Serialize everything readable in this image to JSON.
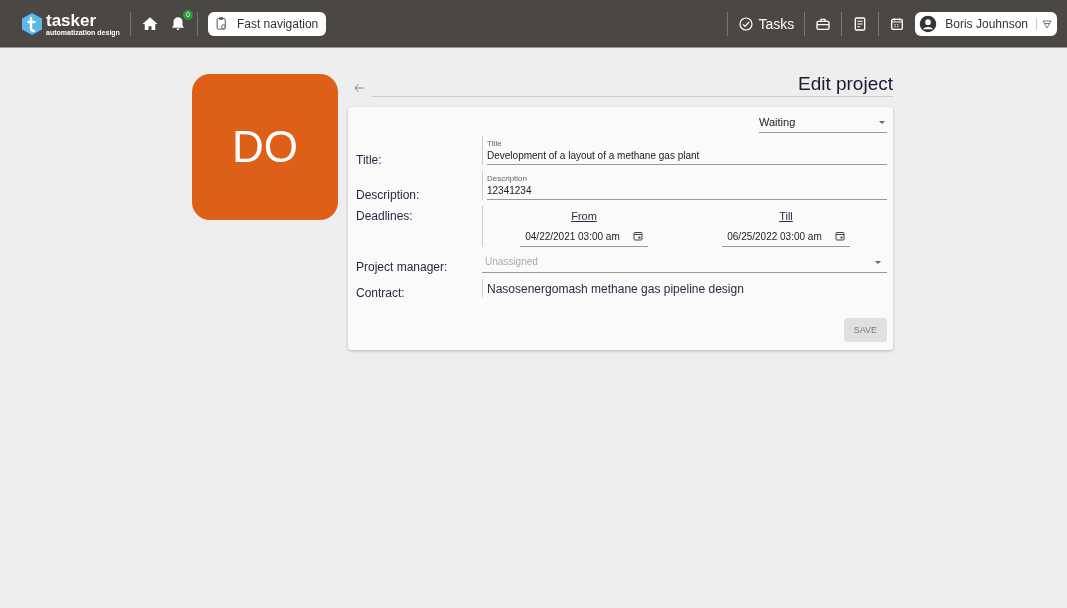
{
  "topbar": {
    "logo": {
      "name": "tasker",
      "tagline": "automatization design"
    },
    "notifications": {
      "count": "0"
    },
    "fast_navigation": "Fast navigation",
    "tasks": "Tasks",
    "user": "Boris Jouhnson"
  },
  "project": {
    "initials": "DO",
    "heading": "Edit project",
    "status": "Waiting",
    "fields": [
      {
        "label": "Title:",
        "kind": "text",
        "placeholder": "Title",
        "value": "Development of a layout of a methane gas plant"
      },
      {
        "label": "Description:",
        "kind": "text",
        "placeholder": "Description",
        "value": "12341234"
      },
      {
        "label": "Deadlines:",
        "kind": "dates",
        "dates": [
          {
            "caption": "From",
            "value": "04/22/2021 03:00 am"
          },
          {
            "caption": "Till",
            "value": "06/25/2022 03:00 am"
          }
        ]
      },
      {
        "label": "Project manager:",
        "kind": "select",
        "placeholder": "Unassigned"
      },
      {
        "label": "Contract:",
        "kind": "static",
        "value": "Nasosenergomash methane gas pipeline design"
      }
    ],
    "save": {
      "label": "SAVE",
      "disabled": true
    }
  }
}
